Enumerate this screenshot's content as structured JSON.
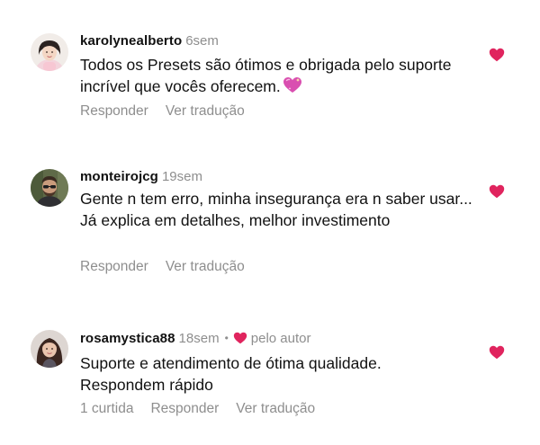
{
  "colors": {
    "liked_heart": "#e0245e",
    "muted_text": "#8e8e8e",
    "primary_text": "#111111"
  },
  "comments": [
    {
      "username": "karolynealberto",
      "time": "6sem",
      "text": "Todos os Presets são ótimos e obrigada pelo suporte incrível que vocês oferecem.",
      "emoji": "sparkling-heart-icon",
      "actions": {
        "reply": "Responder",
        "translate": "Ver tradução"
      },
      "liked": true
    },
    {
      "username": "monteirojcg",
      "time": "19sem",
      "text": "Gente n tem erro, minha insegurança era n saber usar... Já explica em detalhes, melhor investimento",
      "actions": {
        "reply": "Responder",
        "translate": "Ver tradução"
      },
      "liked": true
    },
    {
      "username": "rosamystica88",
      "time": "18sem",
      "separator": "•",
      "liked_by_author_label": "pelo autor",
      "text": "Suporte e atendimento de ótima qualidade. Respondem rápido",
      "actions": {
        "likes": "1 curtida",
        "reply": "Responder",
        "translate": "Ver tradução"
      },
      "liked": true
    }
  ]
}
